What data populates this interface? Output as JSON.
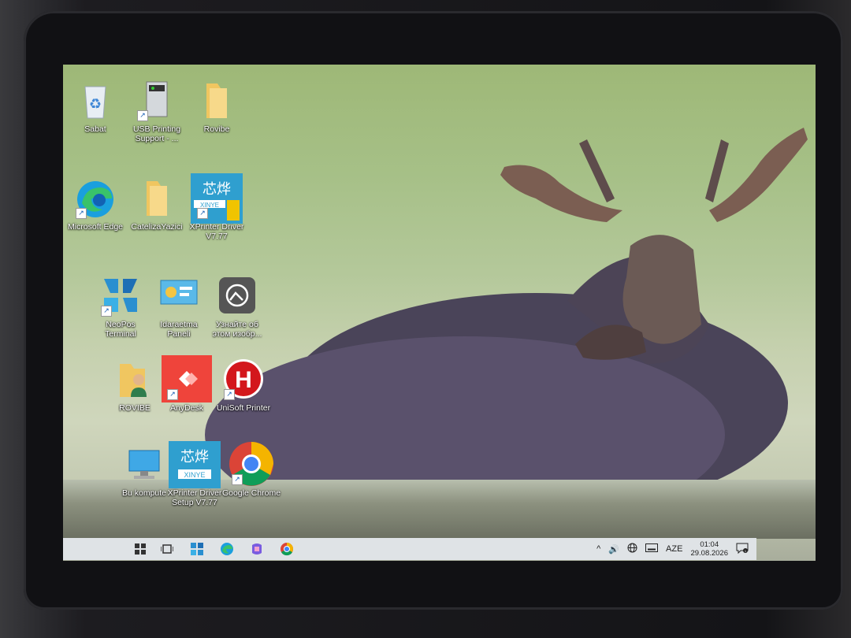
{
  "desktop_icons": [
    {
      "label": "Sabat",
      "icon": "recycle-bin-icon"
    },
    {
      "label": "USB Printing Support - ...",
      "icon": "usb-printer-icon"
    },
    {
      "label": "Rovibe",
      "icon": "folder-icon"
    },
    {
      "label": "Microsoft Edge",
      "icon": "edge-icon"
    },
    {
      "label": "CatelizaYazici",
      "icon": "folder-icon"
    },
    {
      "label": "XPrinter Driver V7.77",
      "icon": "xprinter-icon"
    },
    {
      "label": "NeoPos Terminal",
      "icon": "neopos-icon"
    },
    {
      "label": "Idaraetma Paneli",
      "icon": "control-panel-icon"
    },
    {
      "label": "Узнайте об этом изобр...",
      "icon": "spotlight-icon"
    },
    {
      "label": "ROVIBE",
      "icon": "user-folder-icon"
    },
    {
      "label": "AnyDesk",
      "icon": "anydesk-icon"
    },
    {
      "label": "UniSoft Printer",
      "icon": "unisoft-icon"
    },
    {
      "label": "Bu kompute",
      "icon": "this-pc-icon"
    },
    {
      "label": "XPrinter Driver Setup V7.77",
      "icon": "xprinter-icon"
    },
    {
      "label": "Google Chrome",
      "icon": "chrome-icon"
    }
  ],
  "taskbar": {
    "pinned": [
      "windows-start-icon",
      "task-view-icon",
      "neopos-icon",
      "edge-icon",
      "copilot-icon",
      "chrome-icon"
    ],
    "tray": {
      "chevron": "^",
      "language": "AZE",
      "time": "01:04",
      "date": "29.08.2026"
    }
  },
  "colors": {
    "taskbar_bg": "#dfe3e6",
    "anydesk": "#ef443b",
    "unisoft": "#d3171c"
  }
}
